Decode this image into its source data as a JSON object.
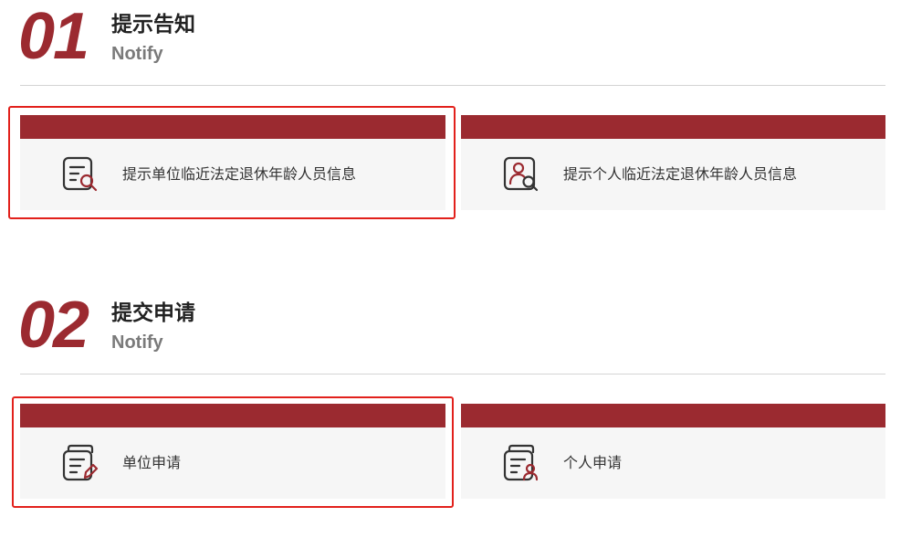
{
  "sections": [
    {
      "number": "01",
      "title": "提示告知",
      "subtitle": "Notify",
      "cards": [
        {
          "label": "提示单位临近法定退休年龄人员信息",
          "icon": "document-search-icon"
        },
        {
          "label": "提示个人临近法定退休年龄人员信息",
          "icon": "person-search-icon"
        }
      ]
    },
    {
      "number": "02",
      "title": "提交申请",
      "subtitle": "Notify",
      "cards": [
        {
          "label": "单位申请",
          "icon": "document-edit-icon"
        },
        {
          "label": "个人申请",
          "icon": "document-person-icon"
        }
      ]
    }
  ],
  "colors": {
    "accent": "#9b2a30",
    "highlight": "#e2211c",
    "card_bg": "#f6f6f6"
  }
}
